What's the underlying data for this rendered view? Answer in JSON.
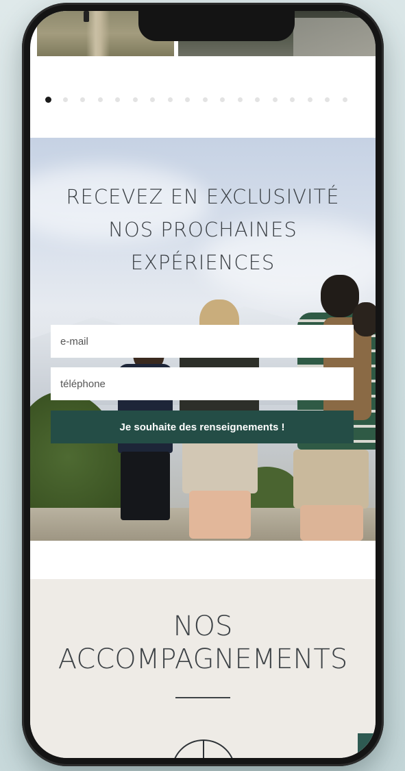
{
  "carousel": {
    "dot_count": 18,
    "active_index": 0
  },
  "newsletter": {
    "title_lines": [
      "RECEVEZ EN EXCLUSIVITÉ",
      "NOS PROCHAINES",
      "EXPÉRIENCES"
    ],
    "email_placeholder": "e-mail",
    "phone_placeholder": "téléphone",
    "submit_label": "Je souhaite des renseignements !"
  },
  "accompagnements": {
    "title_lines": [
      "NOS",
      "ACCOMPAGNEMENTS"
    ]
  },
  "colors": {
    "accent_green": "#244d46",
    "section_bg": "#eeebe6",
    "title_text": "#3a3f44"
  }
}
